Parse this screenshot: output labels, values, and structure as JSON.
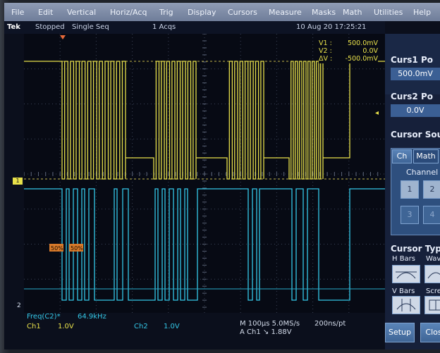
{
  "menu": [
    "File",
    "Edit",
    "Vertical",
    "Horiz/Acq",
    "Trig",
    "Display",
    "Cursors",
    "Measure",
    "Masks",
    "Math",
    "Utilities",
    "Help"
  ],
  "status": {
    "brand": "Tek",
    "state": "Stopped",
    "mode": "Single Seq",
    "acqs": "1 Acqs",
    "datetime": "10 Aug 20 17:25:21"
  },
  "cursor_readout": {
    "v1_label": "V1 :",
    "v1": "500.0mV",
    "v2_label": "V2 :",
    "v2": "0.0V",
    "dv_label": "ΔV :",
    "dv": "-500.0mV"
  },
  "markers": {
    "ch1": "1",
    "ch2": "2",
    "pct1": "50%",
    "pct2": "50%"
  },
  "meas": {
    "freq_label": "Freq(C2)*",
    "freq": "64.9kHz"
  },
  "channels": {
    "ch1_label": "Ch1",
    "ch1_scale": "1.0V",
    "ch2_label": "Ch2",
    "ch2_scale": "1.0V"
  },
  "timebase": {
    "line1": "M 100µs 5.0MS/s",
    "line2": "A  Ch1  ↘  1.88V",
    "res": "200ns/pt"
  },
  "panel": {
    "curs1_title": "Curs1 Po",
    "curs1_val": "500.0mV",
    "curs2_title": "Curs2 Po",
    "curs2_val": "0.0V",
    "source_title": "Cursor Sou",
    "tab_ch": "Ch",
    "tab_math": "Math",
    "channel_label": "Channel",
    "btn1": "1",
    "btn2": "2",
    "btn3": "3",
    "btn4": "4",
    "type_title": "Cursor Typ",
    "hbars": "H Bars",
    "wave": "Wave",
    "vbars": "V Bars",
    "scre": "Scre",
    "setup": "Setup",
    "close": "Clos"
  },
  "colors": {
    "ch1": "#e8e04a",
    "ch2": "#34c8e8",
    "panel": "#16203a"
  },
  "icons": [
    "pointer-arrow-icon",
    "hbars-icon",
    "wave-icon",
    "vbars-icon",
    "screen-icon",
    "trigger-marker-icon"
  ]
}
